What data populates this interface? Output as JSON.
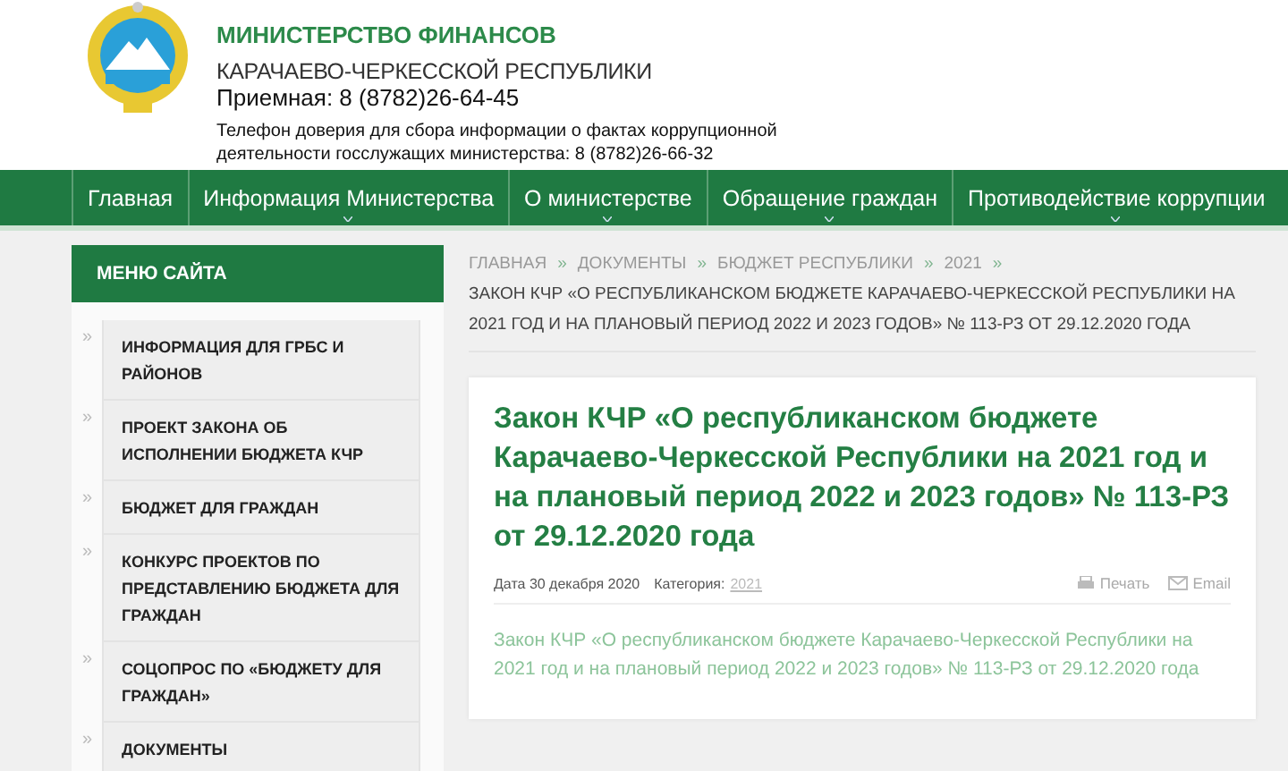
{
  "header": {
    "org_name": "МИНИСТЕРСТВО ФИНАНСОВ",
    "region": "КАРАЧАЕВО-ЧЕРКЕССКОЙ РЕСПУБЛИКИ",
    "reception": "Приемная: 8 (8782)26-64-45",
    "hotline": "Телефон доверия для сбора информации о фактах коррупционной деятельности госслужащих министерства: 8 (8782)26-66-32"
  },
  "nav": [
    {
      "label": "Главная",
      "dropdown": false
    },
    {
      "label": "Информация Министерства",
      "dropdown": true
    },
    {
      "label": "О министерстве",
      "dropdown": true
    },
    {
      "label": "Обращение граждан",
      "dropdown": true
    },
    {
      "label": "Противодействие коррупции",
      "dropdown": true
    }
  ],
  "sidebar": {
    "title": "МЕНЮ САЙТА",
    "items": [
      {
        "label": "ИНФОРМАЦИЯ ДЛЯ ГРБС И РАЙОНОВ",
        "marker": "»"
      },
      {
        "label": "ПРОЕКТ ЗАКОНА ОБ ИСПОЛНЕНИИ БЮДЖЕТА КЧР",
        "marker": "»"
      },
      {
        "label": "БЮДЖЕТ ДЛЯ ГРАЖДАН",
        "marker": "»"
      },
      {
        "label": "КОНКУРС ПРОЕКТОВ ПО ПРЕДСТАВЛЕНИЮ БЮДЖЕТА ДЛЯ ГРАЖДАН",
        "marker": "»"
      },
      {
        "label": "СОЦОПРОС ПО «БЮДЖЕТУ ДЛЯ ГРАЖДАН»",
        "marker": "»"
      },
      {
        "label": "ДОКУМЕНТЫ",
        "marker": "»"
      }
    ]
  },
  "breadcrumb": {
    "links": [
      "ГЛАВНАЯ",
      "ДОКУМЕНТЫ",
      "БЮДЖЕТ РЕСПУБЛИКИ",
      "2021"
    ],
    "current": "ЗАКОН КЧР «О РЕСПУБЛИКАНСКОМ БЮДЖЕТЕ КАРАЧАЕВО-ЧЕРКЕССКОЙ РЕСПУБЛИКИ НА 2021 ГОД И НА ПЛАНОВЫЙ ПЕРИОД 2022 И 2023 ГОДОВ» № 113-РЗ ОТ 29.12.2020 ГОДА"
  },
  "article": {
    "title": "Закон КЧР «О республиканском бюджете Карачаево-Черкесской Республики на 2021 год и на плановый период 2022 и 2023 годов» № 113-РЗ от 29.12.2020 года",
    "date": "Дата 30 декабря 2020",
    "category_label": "Категория:",
    "category": "2021",
    "print": "Печать",
    "email": "Email",
    "body": "Закон КЧР «О республиканском бюджете Карачаево-Черкесской Республики на 2021 год и на плановый период 2022 и 2023 годов» № 113-РЗ от 29.12.2020 года"
  }
}
